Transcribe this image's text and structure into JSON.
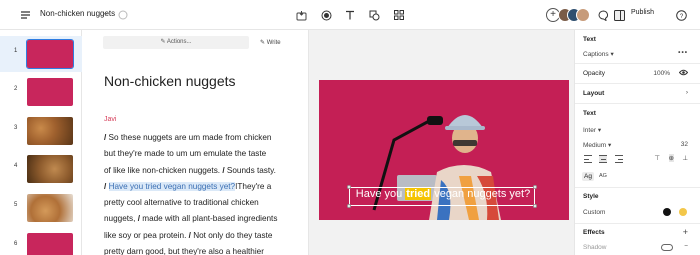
{
  "header": {
    "doc_title": "Non-chicken nuggets",
    "publish_label": "Publish",
    "add_label": "+"
  },
  "thumbnails": [
    {
      "num": "1",
      "color": "#c8265c"
    },
    {
      "num": "2",
      "color": "#c8265c"
    },
    {
      "num": "3",
      "color": "#a0612e"
    },
    {
      "num": "4",
      "color": "#8c5a2c"
    },
    {
      "num": "5",
      "color": "#b07038"
    },
    {
      "num": "6",
      "color": "#c8265c"
    }
  ],
  "editor": {
    "actions_label": "Actions...",
    "write_label": "Write",
    "heading": "Non-chicken nuggets",
    "speaker": "Javi",
    "sep": "/",
    "l1": " So these nuggets are um made from chicken",
    "l2": "but they're made to um um emulate the taste",
    "l3a": "of like like non-chicken nuggets. ",
    "l3b": " Sounds tasty.",
    "l4hl": "Have you tried vegan nuggets yet?",
    "l4b": "They're a",
    "l5": "pretty cool alternative to traditional chicken",
    "l6a": "nuggets, ",
    "l6b": " made with all plant-based ingredients",
    "l7a": "like soy or pea protein. ",
    "l7b": " Not only do they taste",
    "l8": "pretty darn good, but they're also a healthier"
  },
  "caption": {
    "before": "Have you ",
    "highlight": "tried",
    "after": " vegan nuggets yet?"
  },
  "panel": {
    "text_section": "Text",
    "captions_label": "Captions",
    "opacity_label": "Opacity",
    "opacity_value": "100%",
    "layout_label": "Layout",
    "text_label": "Text",
    "font_name": "Inter",
    "weight": "Medium",
    "size": "32",
    "case_upper": "Ag",
    "case_caps": "AG",
    "style_label": "Style",
    "style_value": "Custom",
    "effects_label": "Effects",
    "shadow_label": "Shadow",
    "swatch_colors": [
      "#111111",
      "#f3c74a"
    ]
  }
}
